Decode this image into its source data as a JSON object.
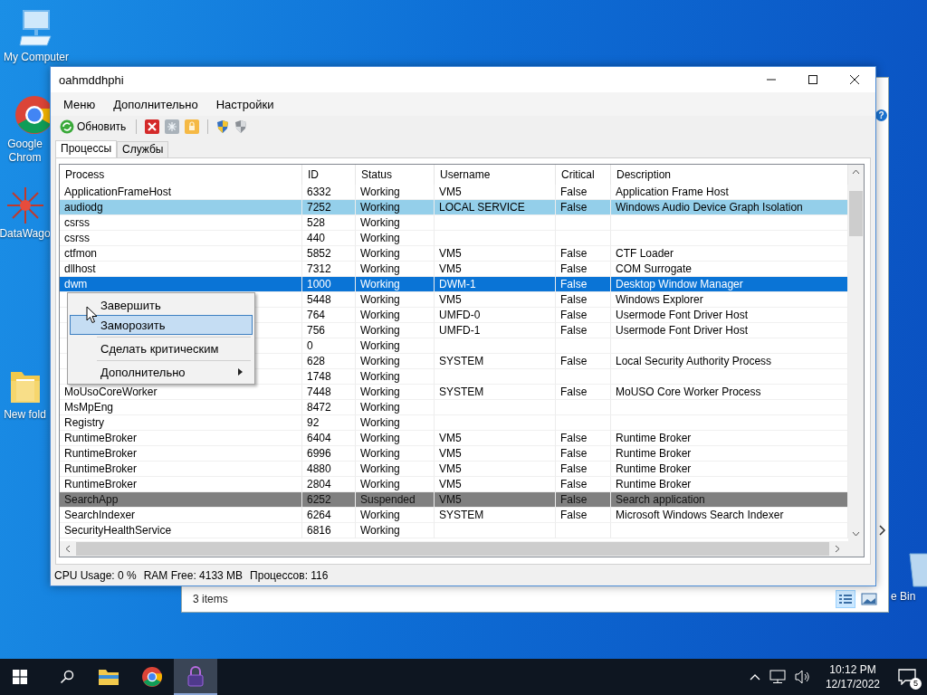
{
  "desktop_icons": [
    {
      "kind": "computer",
      "label": "My Computer"
    },
    {
      "kind": "chrome",
      "label": "Google Chrom"
    },
    {
      "kind": "app",
      "label": "DataWago"
    },
    {
      "kind": "folder",
      "label": "New fold"
    },
    {
      "kind": "bin",
      "label": "e Bin"
    }
  ],
  "background_window": {
    "help": "?",
    "status": "3 items"
  },
  "window": {
    "title": "oahmddhphi",
    "menu": [
      "Меню",
      "Дополнительно",
      "Настройки"
    ],
    "toolbar": {
      "refresh": "Обновить"
    },
    "tabs": [
      {
        "label": "Процессы",
        "selected": true
      },
      {
        "label": "Службы",
        "selected": false
      }
    ],
    "table": {
      "columns": [
        "Process",
        "ID",
        "Status",
        "Username",
        "Critical",
        "Description"
      ],
      "rows": [
        {
          "process": "ApplicationFrameHost",
          "id": "6332",
          "status": "Working",
          "user": "VM5",
          "critical": "False",
          "description": "Application Frame Host",
          "selected": false,
          "highlighted": false,
          "suspended": false
        },
        {
          "process": "audiodg",
          "id": "7252",
          "status": "Working",
          "user": "LOCAL SERVICE",
          "critical": "False",
          "description": "Windows Audio Device Graph Isolation",
          "selected": false,
          "highlighted": true,
          "suspended": false
        },
        {
          "process": "csrss",
          "id": "528",
          "status": "Working",
          "selected": false,
          "highlighted": false,
          "suspended": false
        },
        {
          "process": "csrss",
          "id": "440",
          "status": "Working",
          "selected": false,
          "highlighted": false,
          "suspended": false
        },
        {
          "process": "ctfmon",
          "id": "5852",
          "status": "Working",
          "user": "VM5",
          "critical": "False",
          "description": "CTF Loader",
          "selected": false,
          "highlighted": false,
          "suspended": false
        },
        {
          "process": "dllhost",
          "id": "7312",
          "status": "Working",
          "user": "VM5",
          "critical": "False",
          "description": "COM Surrogate",
          "selected": false,
          "highlighted": false,
          "suspended": false
        },
        {
          "process": "dwm",
          "id": "1000",
          "status": "Working",
          "user": "DWM-1",
          "critical": "False",
          "description": "Desktop Window Manager",
          "selected": true,
          "highlighted": false,
          "suspended": false
        },
        {
          "id": "5448",
          "status": "Working",
          "user": "VM5",
          "critical": "False",
          "description": "Windows Explorer",
          "selected": false,
          "highlighted": false,
          "suspended": false
        },
        {
          "id": "764",
          "status": "Working",
          "user": "UMFD-0",
          "critical": "False",
          "description": "Usermode Font Driver Host",
          "selected": false,
          "highlighted": false,
          "suspended": false
        },
        {
          "id": "756",
          "status": "Working",
          "user": "UMFD-1",
          "critical": "False",
          "description": "Usermode Font Driver Host",
          "selected": false,
          "highlighted": false,
          "suspended": false
        },
        {
          "id": "0",
          "status": "Working",
          "selected": false,
          "highlighted": false,
          "suspended": false
        },
        {
          "id": "628",
          "status": "Working",
          "user": "SYSTEM",
          "critical": "False",
          "description": "Local Security Authority Process",
          "selected": false,
          "highlighted": false,
          "suspended": false
        },
        {
          "id": "1748",
          "status": "Working",
          "selected": false,
          "highlighted": false,
          "suspended": false
        },
        {
          "process": "MoUsoCoreWorker",
          "id": "7448",
          "status": "Working",
          "user": "SYSTEM",
          "critical": "False",
          "description": "MoUSO Core Worker Process",
          "selected": false,
          "highlighted": false,
          "suspended": false
        },
        {
          "process": "MsMpEng",
          "id": "8472",
          "status": "Working",
          "selected": false,
          "highlighted": false,
          "suspended": false
        },
        {
          "process": "Registry",
          "id": "92",
          "status": "Working",
          "selected": false,
          "highlighted": false,
          "suspended": false
        },
        {
          "process": "RuntimeBroker",
          "id": "6404",
          "status": "Working",
          "user": "VM5",
          "critical": "False",
          "description": "Runtime Broker",
          "selected": false,
          "highlighted": false,
          "suspended": false
        },
        {
          "process": "RuntimeBroker",
          "id": "6996",
          "status": "Working",
          "user": "VM5",
          "critical": "False",
          "description": "Runtime Broker",
          "selected": false,
          "highlighted": false,
          "suspended": false
        },
        {
          "process": "RuntimeBroker",
          "id": "4880",
          "status": "Working",
          "user": "VM5",
          "critical": "False",
          "description": "Runtime Broker",
          "selected": false,
          "highlighted": false,
          "suspended": false
        },
        {
          "process": "RuntimeBroker",
          "id": "2804",
          "status": "Working",
          "user": "VM5",
          "critical": "False",
          "description": "Runtime Broker",
          "selected": false,
          "highlighted": false,
          "suspended": false
        },
        {
          "process": "SearchApp",
          "id": "6252",
          "status": "Suspended",
          "user": "VM5",
          "critical": "False",
          "description": "Search application",
          "selected": false,
          "highlighted": false,
          "suspended": true
        },
        {
          "process": "SearchIndexer",
          "id": "6264",
          "status": "Working",
          "user": "SYSTEM",
          "critical": "False",
          "description": "Microsoft Windows Search Indexer",
          "selected": false,
          "highlighted": false,
          "suspended": false
        },
        {
          "process": "SecurityHealthService",
          "id": "6816",
          "status": "Working",
          "selected": false,
          "highlighted": false,
          "suspended": false
        }
      ]
    },
    "context_menu": {
      "items": [
        {
          "kind": "item",
          "label": "Завершить",
          "selected": false
        },
        {
          "kind": "item",
          "label": "Заморозить",
          "selected": true
        },
        {
          "kind": "separator"
        },
        {
          "kind": "item",
          "label": "Сделать критическим",
          "selected": false
        },
        {
          "kind": "separator"
        },
        {
          "kind": "submenu",
          "label": "Дополнительно",
          "selected": false
        }
      ]
    },
    "status_bar": [
      "CPU Usage: 0 %",
      "RAM Free: 4133 MB",
      "Процессов: 116"
    ]
  },
  "taskbar": {
    "apps": [
      {
        "kind": "explorer",
        "active": false
      },
      {
        "kind": "chrome",
        "active": false
      },
      {
        "kind": "lock",
        "active": true
      }
    ],
    "time": "10:12 PM",
    "date": "12/17/2022",
    "notifications": "5"
  }
}
